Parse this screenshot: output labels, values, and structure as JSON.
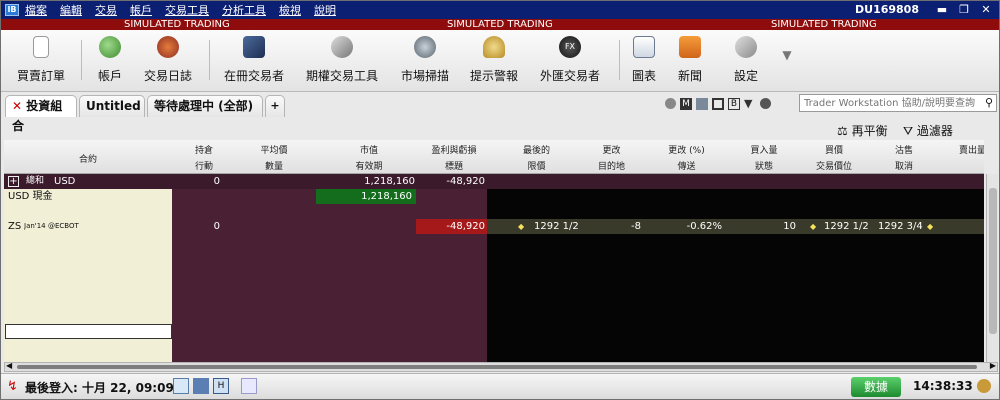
{
  "app": {
    "logo_text": "IB",
    "account": "DU169808"
  },
  "menu": [
    "檔案",
    "編輯",
    "交易",
    "帳戶",
    "交易工具",
    "分析工具",
    "檢視",
    "說明"
  ],
  "window_controls": {
    "minimize": "▬",
    "restore": "❐",
    "close": "✕"
  },
  "sim_banner": [
    "SIMULATED TRADING",
    "SIMULATED TRADING",
    "SIMULATED TRADING"
  ],
  "toolbar": [
    {
      "label": "買賣訂單",
      "icon": "order-icon"
    },
    {
      "label": "帳戶",
      "icon": "account-icon"
    },
    {
      "label": "交易日誌",
      "icon": "journal-icon"
    },
    {
      "label": "在冊交易者",
      "icon": "book-trader-icon"
    },
    {
      "label": "期權交易工具",
      "icon": "options-tool-icon"
    },
    {
      "label": "市場掃描",
      "icon": "scanner-icon"
    },
    {
      "label": "提示警報",
      "icon": "alert-bell-icon"
    },
    {
      "label": "外匯交易者",
      "icon": "fx-trader-icon"
    },
    {
      "label": "圖表",
      "icon": "chart-icon"
    },
    {
      "label": "新聞",
      "icon": "news-rss-icon"
    },
    {
      "label": "設定",
      "icon": "settings-icon"
    }
  ],
  "tabs": [
    {
      "label": "投資組合",
      "active": true
    },
    {
      "label": "Untitled",
      "active": false
    },
    {
      "label": "等待處理中 (全部)",
      "active": false
    },
    {
      "label": "+",
      "active": false
    }
  ],
  "search": {
    "placeholder": "Trader Workstation 協助/說明要查詢"
  },
  "actions": {
    "rebalance": "再平衡",
    "filter": "過濾器"
  },
  "columns": {
    "contract": "合約",
    "top": [
      "持倉",
      "平均價",
      "市值",
      "盈利與虧損",
      "最後的",
      "更改",
      "更改 (%)",
      "買入量",
      "買價",
      "沽售",
      "賣出量"
    ],
    "bottom": [
      "行動",
      "數量",
      "有效期",
      "標題",
      "限價",
      "目的地",
      "傳送",
      "狀態",
      "交易價位",
      "取消",
      ""
    ]
  },
  "rows": {
    "total": {
      "expand": "+",
      "label1": "總和",
      "label2": "USD",
      "position": "0",
      "market_value": "1,218,160",
      "pnl": "-48,920"
    },
    "cash": {
      "label": "USD 現金",
      "market_value": "1,218,160"
    },
    "zs": {
      "contract": "ZS",
      "expiry": "Jan'14",
      "exchange": "@ECBOT",
      "position": "0",
      "pnl": "-48,920",
      "last": "1292 1/2",
      "change": "-8",
      "change_pct": "-0.62%",
      "bid_size": "10",
      "bid": "1292 1/2",
      "ask": "1292 3/4"
    }
  },
  "status": {
    "last_login": "最後登入: 十月 22, 09:09",
    "data_button": "數據",
    "clock": "14:38:33"
  },
  "colors": {
    "menu_bg": "#0b1f73",
    "sim_bg": "#8e0c0c",
    "pnl_neg": "#a5191b",
    "mkt_pos": "#136d1c",
    "data_btn": "#2fa846"
  }
}
